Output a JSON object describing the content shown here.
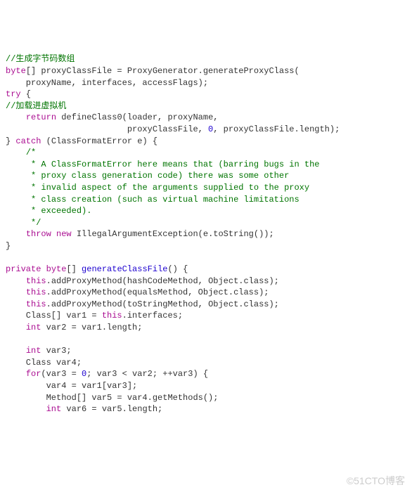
{
  "watermark": "©51CTO博客",
  "code_lines": [
    {
      "segments": [
        {
          "cls": "cm",
          "t": "//生成字节码数组"
        }
      ]
    },
    {
      "segments": [
        {
          "cls": "kw",
          "t": "byte"
        },
        {
          "cls": "pl",
          "t": "[] proxyClassFile = ProxyGenerator.generateProxyClass("
        }
      ]
    },
    {
      "segments": [
        {
          "cls": "pl",
          "t": "    proxyName, interfaces, accessFlags);"
        }
      ]
    },
    {
      "segments": [
        {
          "cls": "kw",
          "t": "try"
        },
        {
          "cls": "pl",
          "t": " {"
        }
      ]
    },
    {
      "segments": [
        {
          "cls": "cm",
          "t": "//加载进虚拟机"
        }
      ]
    },
    {
      "segments": [
        {
          "cls": "pl",
          "t": "    "
        },
        {
          "cls": "kw",
          "t": "return"
        },
        {
          "cls": "pl",
          "t": " defineClass0(loader, proxyName,"
        }
      ]
    },
    {
      "segments": [
        {
          "cls": "pl",
          "t": "                        proxyClassFile, "
        },
        {
          "cls": "num",
          "t": "0"
        },
        {
          "cls": "pl",
          "t": ", proxyClassFile.length);"
        }
      ]
    },
    {
      "segments": [
        {
          "cls": "pl",
          "t": "} "
        },
        {
          "cls": "kw",
          "t": "catch"
        },
        {
          "cls": "pl",
          "t": " (ClassFormatError e) {"
        }
      ]
    },
    {
      "segments": [
        {
          "cls": "pl",
          "t": "    "
        },
        {
          "cls": "cm",
          "t": "/*"
        }
      ]
    },
    {
      "segments": [
        {
          "cls": "pl",
          "t": "     "
        },
        {
          "cls": "cm",
          "t": "* A ClassFormatError here means that (barring bugs in the"
        }
      ]
    },
    {
      "segments": [
        {
          "cls": "pl",
          "t": "     "
        },
        {
          "cls": "cm",
          "t": "* proxy class generation code) there was some other"
        }
      ]
    },
    {
      "segments": [
        {
          "cls": "pl",
          "t": "     "
        },
        {
          "cls": "cm",
          "t": "* invalid aspect of the arguments supplied to the proxy"
        }
      ]
    },
    {
      "segments": [
        {
          "cls": "pl",
          "t": "     "
        },
        {
          "cls": "cm",
          "t": "* class creation (such as virtual machine limitations"
        }
      ]
    },
    {
      "segments": [
        {
          "cls": "pl",
          "t": "     "
        },
        {
          "cls": "cm",
          "t": "* exceeded)."
        }
      ]
    },
    {
      "segments": [
        {
          "cls": "pl",
          "t": "     "
        },
        {
          "cls": "cm",
          "t": "*/"
        }
      ]
    },
    {
      "segments": [
        {
          "cls": "pl",
          "t": "    "
        },
        {
          "cls": "kw",
          "t": "throw"
        },
        {
          "cls": "pl",
          "t": " "
        },
        {
          "cls": "kw",
          "t": "new"
        },
        {
          "cls": "pl",
          "t": " IllegalArgumentException(e.toString());"
        }
      ]
    },
    {
      "segments": [
        {
          "cls": "pl",
          "t": "}"
        }
      ]
    },
    {
      "segments": []
    },
    {
      "segments": [
        {
          "cls": "kw",
          "t": "private"
        },
        {
          "cls": "pl",
          "t": " "
        },
        {
          "cls": "kw",
          "t": "byte"
        },
        {
          "cls": "pl",
          "t": "[] "
        },
        {
          "cls": "fn",
          "t": "generateClassFile"
        },
        {
          "cls": "pl",
          "t": "() {"
        }
      ]
    },
    {
      "segments": [
        {
          "cls": "pl",
          "t": "    "
        },
        {
          "cls": "kw",
          "t": "this"
        },
        {
          "cls": "pl",
          "t": ".addProxyMethod(hashCodeMethod, Object.class);"
        }
      ]
    },
    {
      "segments": [
        {
          "cls": "pl",
          "t": "    "
        },
        {
          "cls": "kw",
          "t": "this"
        },
        {
          "cls": "pl",
          "t": ".addProxyMethod(equalsMethod, Object.class);"
        }
      ]
    },
    {
      "segments": [
        {
          "cls": "pl",
          "t": "    "
        },
        {
          "cls": "kw",
          "t": "this"
        },
        {
          "cls": "pl",
          "t": ".addProxyMethod(toStringMethod, Object.class);"
        }
      ]
    },
    {
      "segments": [
        {
          "cls": "pl",
          "t": "    Class[] var1 = "
        },
        {
          "cls": "kw",
          "t": "this"
        },
        {
          "cls": "pl",
          "t": ".interfaces;"
        }
      ]
    },
    {
      "segments": [
        {
          "cls": "pl",
          "t": "    "
        },
        {
          "cls": "kw",
          "t": "int"
        },
        {
          "cls": "pl",
          "t": " var2 = var1.length;"
        }
      ]
    },
    {
      "segments": []
    },
    {
      "segments": [
        {
          "cls": "pl",
          "t": "    "
        },
        {
          "cls": "kw",
          "t": "int"
        },
        {
          "cls": "pl",
          "t": " var3;"
        }
      ]
    },
    {
      "segments": [
        {
          "cls": "pl",
          "t": "    Class var4;"
        }
      ]
    },
    {
      "segments": [
        {
          "cls": "pl",
          "t": "    "
        },
        {
          "cls": "kw",
          "t": "for"
        },
        {
          "cls": "pl",
          "t": "(var3 = "
        },
        {
          "cls": "num",
          "t": "0"
        },
        {
          "cls": "pl",
          "t": "; var3 < var2; ++var3) {"
        }
      ]
    },
    {
      "segments": [
        {
          "cls": "pl",
          "t": "        var4 = var1[var3];"
        }
      ]
    },
    {
      "segments": [
        {
          "cls": "pl",
          "t": "        Method[] var5 = var4.getMethods();"
        }
      ]
    },
    {
      "segments": [
        {
          "cls": "pl",
          "t": "        "
        },
        {
          "cls": "kw",
          "t": "int"
        },
        {
          "cls": "pl",
          "t": " var6 = var5.length;"
        }
      ]
    }
  ]
}
